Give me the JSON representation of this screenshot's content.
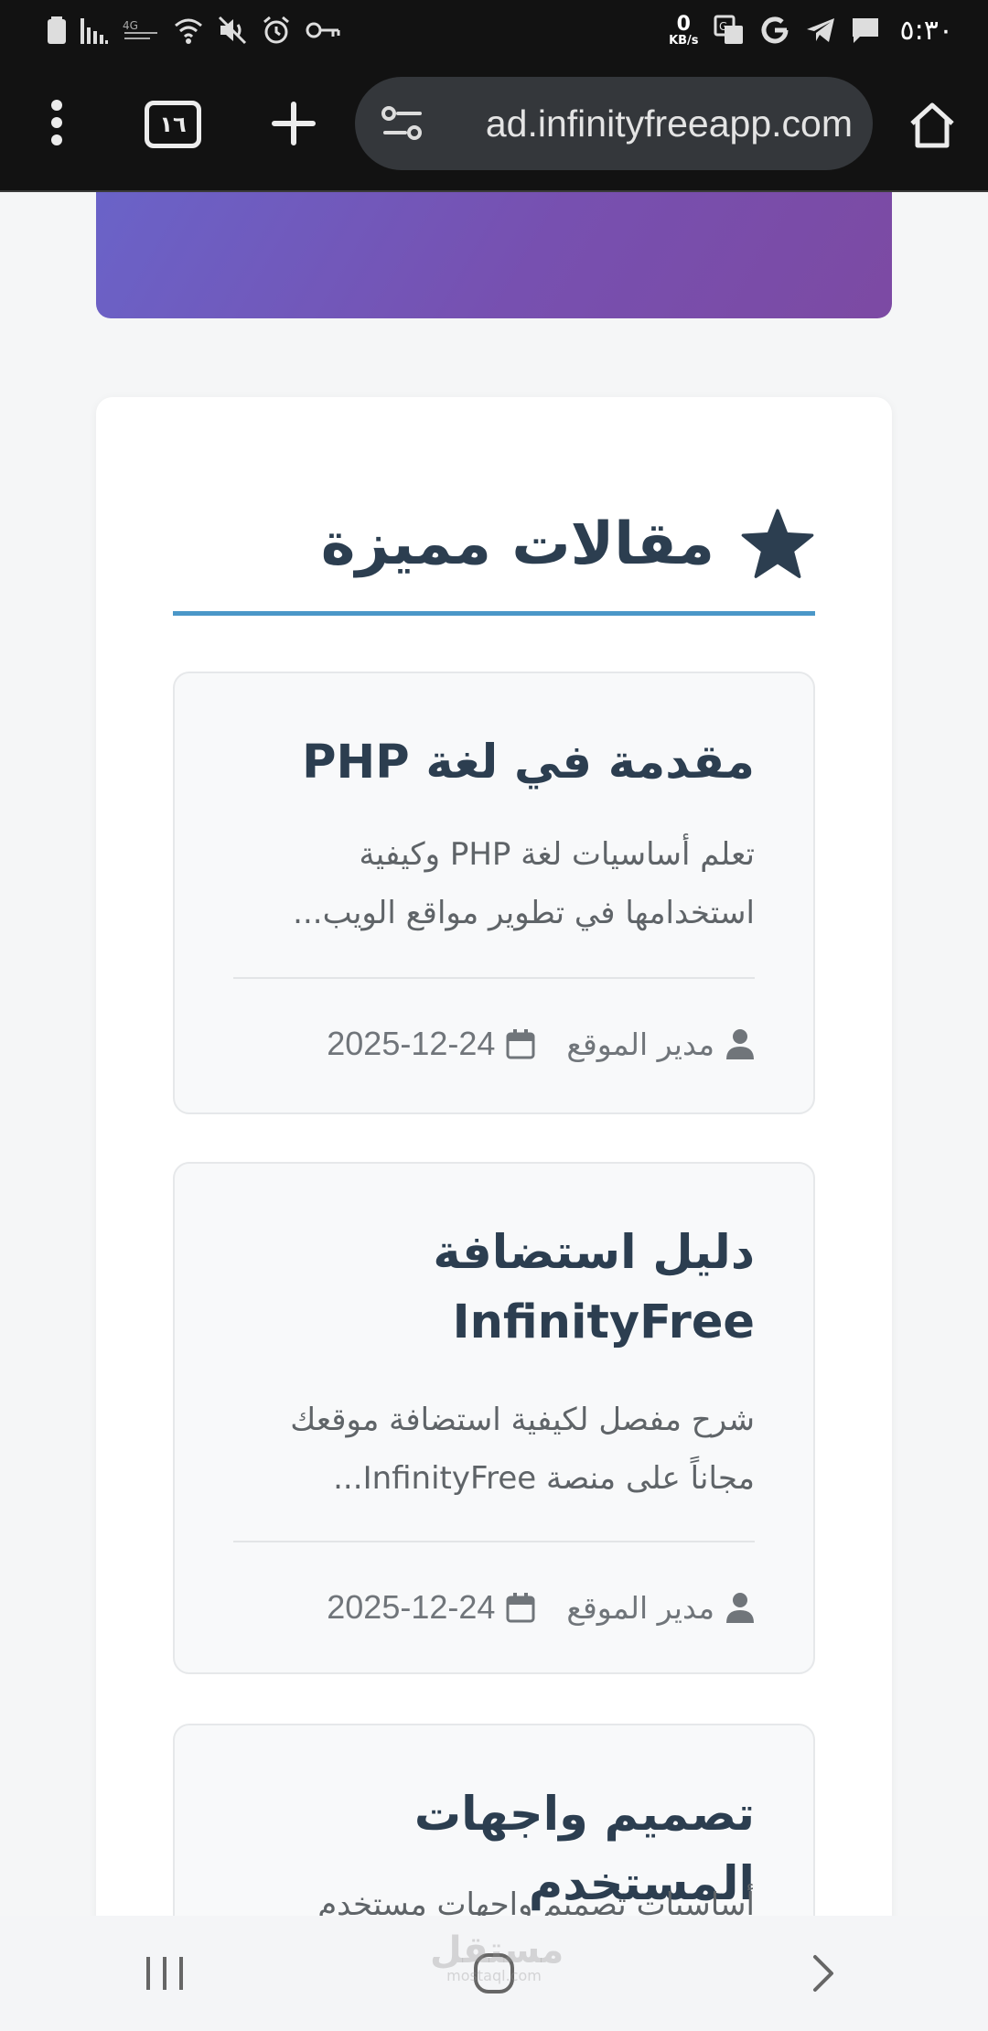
{
  "status_bar": {
    "time": "٥:٣٠",
    "net_speed_value": "0",
    "net_speed_unit": "KB/s",
    "left_icons": [
      "battery-icon",
      "signal-icon",
      "volte-icon",
      "wifi-icon",
      "mute-icon",
      "alarm-icon",
      "vpn-key-icon"
    ],
    "right_icons": [
      "translate-icon",
      "google-icon",
      "telegram-icon",
      "message-icon"
    ]
  },
  "browser": {
    "tab_count": "١٦",
    "url": "ad.infinityfreeapp.com"
  },
  "featured": {
    "title": "مقالات مميزة",
    "articles": [
      {
        "title": "مقدمة في لغة PHP",
        "excerpt": "تعلم أساسيات لغة PHP وكيفية استخدامها في تطوير مواقع الويب...",
        "author": "مدير الموقع",
        "date": "2025-12-24"
      },
      {
        "title": "دليل استضافة InfinityFree",
        "excerpt": "شرح مفصل لكيفية استضافة موقعك مجاناً على منصة InfinityFree...",
        "author": "مدير الموقع",
        "date": "2025-12-24"
      },
      {
        "title": "تصميم واجهات المستخدم",
        "excerpt": "أساسيات تصميم واجهات مستخدم"
      }
    ]
  },
  "watermark": {
    "text": "مستقل",
    "sub": "mostaql.com"
  },
  "colors": {
    "heading": "#2c3e50",
    "accent_rule": "#4a97c8",
    "banner_start": "#6a63c8",
    "banner_end": "#7c4aa3"
  }
}
